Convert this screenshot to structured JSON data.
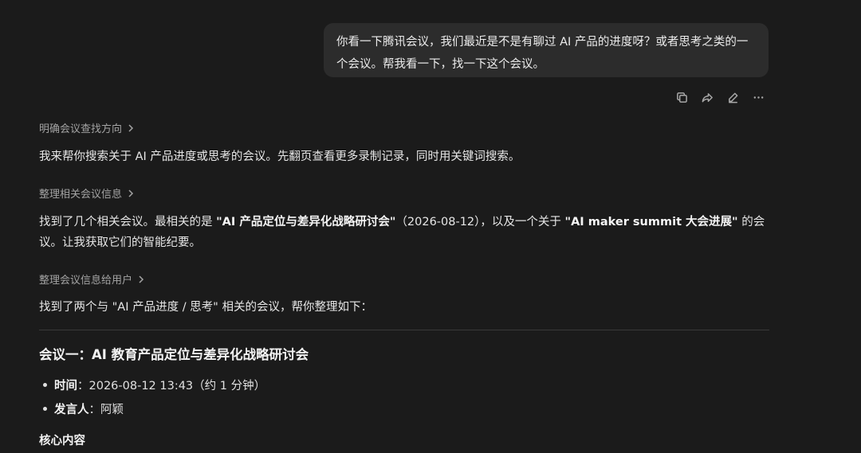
{
  "user_message": {
    "text": "你看一下腾讯会议，我们最近是不是有聊过 AI 产品的进度呀？或者思考之类的一个会议。帮我看一下，找一下这个会议。"
  },
  "message_actions": [
    {
      "icon": "copy-icon"
    },
    {
      "icon": "share-icon"
    },
    {
      "icon": "edit-icon"
    },
    {
      "icon": "more-icon"
    }
  ],
  "steps": [
    {
      "label": "明确会议查找方向"
    },
    {
      "label": "整理相关会议信息"
    },
    {
      "label": "整理会议信息给用户"
    }
  ],
  "paragraphs": {
    "p1": "我来帮你搜索关于 AI 产品进度或思考的会议。先翻页查看更多录制记录，同时用关键词搜索。",
    "p2_a": "找到了几个相关会议。最相关的是 ",
    "p2_b": "\"AI 产品定位与差异化战略研讨会\"",
    "p2_c": "（2026-08-12），以及一个关于 ",
    "p2_d": "\"AI maker summit 大会进展\"",
    "p2_e": " 的会议。让我获取它们的智能纪要。",
    "p3": "找到了两个与 \"AI 产品进度 / 思考\" 相关的会议，帮你整理如下："
  },
  "meeting1": {
    "title": "会议一：AI 教育产品定位与差异化战略研讨会",
    "time_key": "时间",
    "time_value": "：2026-08-12 13:43（约 1 分钟）",
    "speaker_key": "发言人",
    "speaker_value": "：阿颖",
    "section": "核心内容"
  }
}
